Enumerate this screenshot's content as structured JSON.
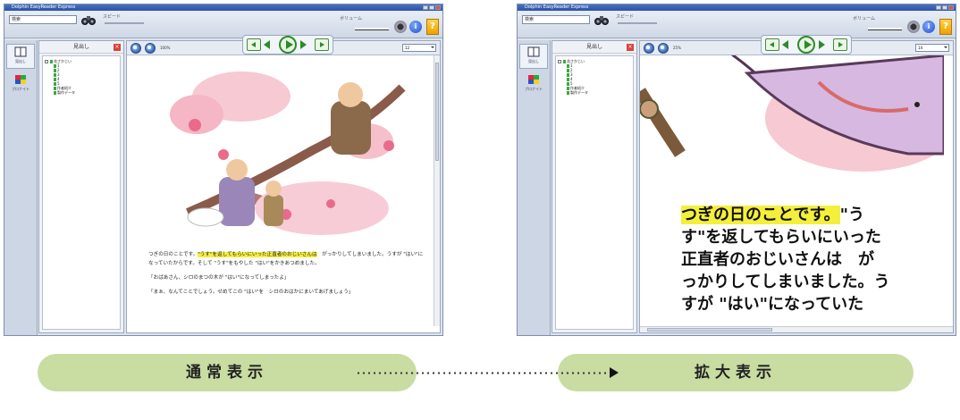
{
  "left_window": {
    "title": "Dolphin EasyReader Express",
    "search_value": "検索",
    "speed_label": "スピード",
    "volume_label": "ボリューム",
    "panel_title": "見出し",
    "side_tabs": [
      "見出し",
      "ブロナイト"
    ],
    "tree_root": "花さかじい",
    "tree_children": [
      "1",
      "2",
      "3",
      "4",
      "5",
      "作者紹介",
      "製作データ"
    ],
    "zoom_level": "100%",
    "page_value": "12",
    "paragraphs": [
      {
        "pre": "つぎの日のことです。",
        "highlight": "\"うす\"を返してもらいにいった正直者のおじいさんは",
        "post": "　がっかりしてしまいました。うすが \"はい\"になっていたからです。そして \"うす\"をもやした \"はい\"をかきあつめました。"
      },
      {
        "pre": "「おばあさん、シロのまつの木が \"はい\"になってしまったよ」",
        "highlight": "",
        "post": ""
      },
      {
        "pre": "「まぁ、なんてことでしょう。せめてこの \"はい\"を　シロのおはかにまいてあげましょう」",
        "highlight": "",
        "post": ""
      }
    ]
  },
  "right_window": {
    "title": "Dolphin EasyReader Express",
    "search_value": "検索",
    "speed_label": "スピード",
    "volume_label": "ボリューム",
    "panel_title": "見出し",
    "side_tabs": [
      "見出し",
      "ブロナイト"
    ],
    "tree_root": "花さかじい",
    "tree_children": [
      "1",
      "2",
      "3",
      "4",
      "5",
      "作者紹介",
      "製作データ"
    ],
    "zoom_level": "25%",
    "page_value": "14",
    "zoom_lines": [
      {
        "highlight": "つぎの日のことです。",
        "rest": "\"う"
      },
      {
        "highlight": "",
        "rest": "す\"を返してもらいにいった"
      },
      {
        "highlight": "",
        "rest": "正直者のおじいさんは　が"
      },
      {
        "highlight": "",
        "rest": "っかりしてしまいました。う"
      },
      {
        "highlight": "",
        "rest": "すが \"はい\"になっていた"
      }
    ]
  },
  "labels": {
    "normal": "通常表示",
    "zoom": "拡大表示"
  },
  "colors": {
    "pill": "#c9dca2",
    "highlight": "#f4ef3c"
  }
}
